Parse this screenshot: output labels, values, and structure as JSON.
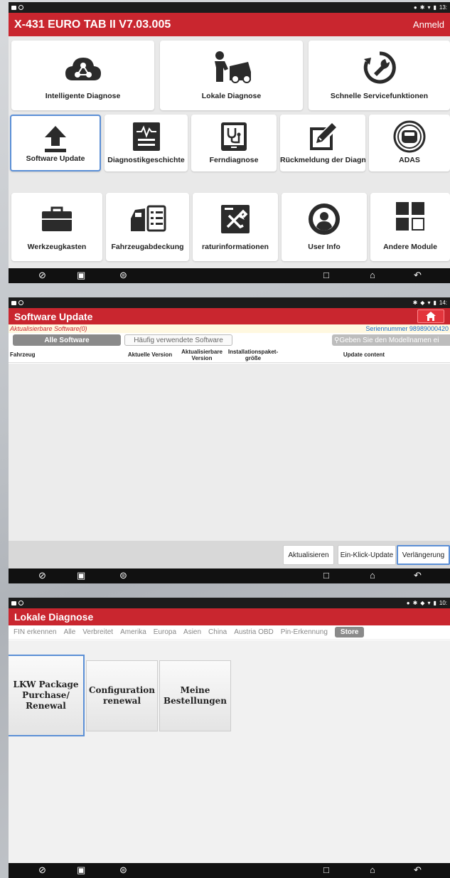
{
  "screen1": {
    "status_time": "13:",
    "title": "X-431 EURO TAB II V7.03.005",
    "login": "Anmeld",
    "tiles": [
      {
        "label": "Intelligente Diagnose",
        "icon": "cloud-diagnose-icon"
      },
      {
        "label": "Lokale Diagnose",
        "icon": "mechanic-car-icon"
      },
      {
        "label": "Schnelle Servicefunktionen",
        "icon": "wrench-circle-icon"
      },
      {
        "label": "Software Update",
        "icon": "upload-arrow-icon"
      },
      {
        "label": "Diagnostikgeschichte",
        "icon": "history-waveform-icon"
      },
      {
        "label": "Ferndiagnose",
        "icon": "stethoscope-tablet-icon"
      },
      {
        "label": "Rückmeldung der Diagn",
        "icon": "pencil-feedback-icon"
      },
      {
        "label": "ADAS",
        "icon": "adas-car-radar-icon"
      },
      {
        "label": "Werkzeugkasten",
        "icon": "toolbox-icon"
      },
      {
        "label": "Fahrzeugabdeckung",
        "icon": "vehicle-coverage-icon"
      },
      {
        "label": "raturinformationen",
        "icon": "repair-info-icon"
      },
      {
        "label": "User Info",
        "icon": "user-circle-icon"
      },
      {
        "label": "Andere Module",
        "icon": "modules-grid-icon"
      }
    ]
  },
  "screen2": {
    "status_time": "14:",
    "title": "Software Update",
    "updatable": "Aktualisierbare Software(0)",
    "serial": "Seriennummer 98989000420",
    "tab_all": "Alle Software",
    "tab_frequent": "Häufig verwendete Software",
    "search_placeholder": "Geben Sie den Modellnamen ei",
    "columns": {
      "vehicle": "Fahrzeug",
      "current_version": "Aktuelle Version",
      "updatable_version": "Aktualisierbare Version",
      "package_size": "Installationspaket-größe",
      "update_content": "Update content"
    },
    "buttons": {
      "refresh": "Aktualisieren",
      "one_click": "Ein-Klick-Update",
      "renew": "Verlängerung"
    }
  },
  "screen3": {
    "status_time": "10:",
    "title": "Lokale Diagnose",
    "categories": [
      "FIN erkennen",
      "Alle",
      "Verbreitet",
      "Amerika",
      "Europa",
      "Asien",
      "China",
      "Austria OBD",
      "Pin-Erkennung"
    ],
    "store": "Store",
    "store_buttons": [
      "LKW Package Purchase/ Renewal",
      "Configuration renewal",
      "Meine Bestellungen"
    ]
  },
  "colors": {
    "brand_red": "#c9262f",
    "selection_blue": "#5b8fd6",
    "serial_blue": "#1a6dc9"
  }
}
